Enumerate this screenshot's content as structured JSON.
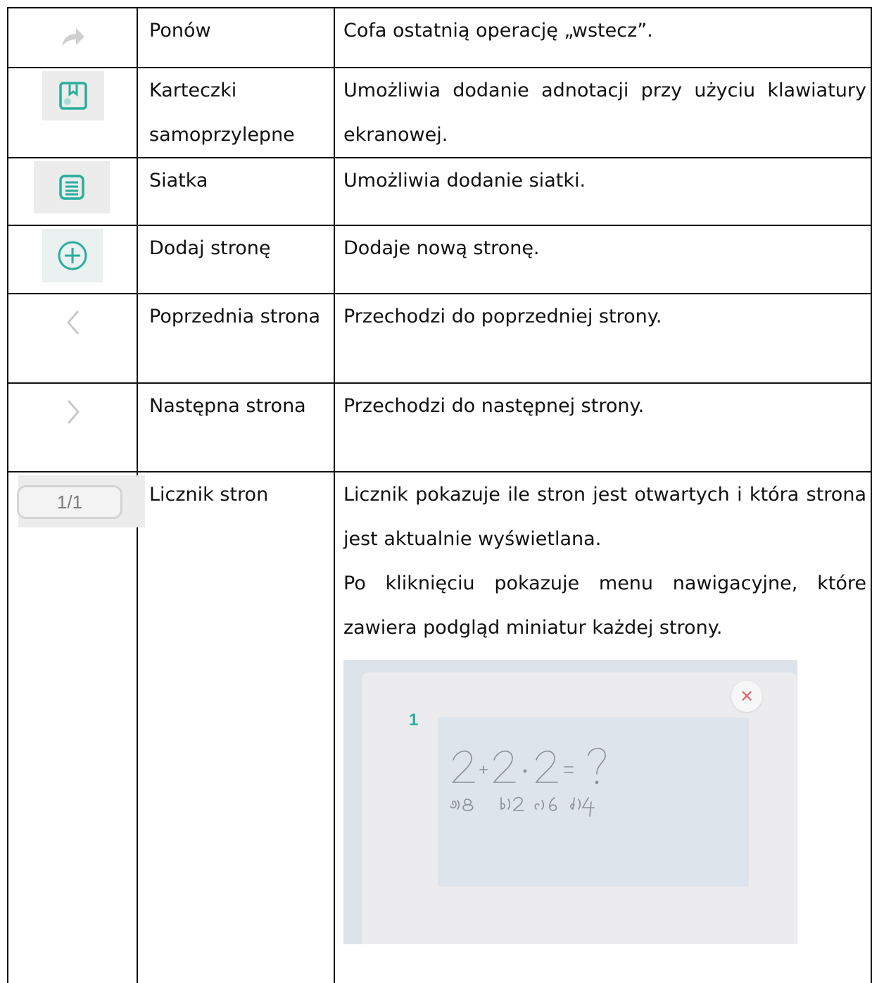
{
  "rows": [
    {
      "icon": "redo-arrow-icon",
      "name": "Ponów",
      "description": [
        "Cofa ostatnią operację „wstecz”."
      ]
    },
    {
      "icon": "sticky-note-icon",
      "name": "Karteczki samoprzylepne",
      "description": [
        "Umożliwia dodanie adnotacji przy użyciu klawiatury ekranowej."
      ]
    },
    {
      "icon": "grid-lines-icon",
      "name": "Siatka",
      "description": [
        "Umożliwia dodanie siatki."
      ]
    },
    {
      "icon": "add-page-plus-icon",
      "name": "Dodaj stronę",
      "description": [
        "Dodaje nową stronę."
      ]
    },
    {
      "icon": "chevron-left-icon",
      "name": "Poprzednia strona",
      "description": [
        "Przechodzi do poprzedniej strony."
      ]
    },
    {
      "icon": "chevron-right-icon",
      "name": "Następna strona",
      "description": [
        "Przechodzi do następnej strony."
      ]
    },
    {
      "icon": "page-counter",
      "counter_text": "1/1",
      "name": "Licznik stron",
      "description": [
        "Licznik pokazuje ile stron jest otwartych i która strona jest aktualnie wyświetlana.",
        "Po kliknięciu pokazuje menu nawigacyjne, które zawiera podgląd miniatur każdej strony."
      ],
      "nav_menu_preview": {
        "page_number": "1",
        "close_symbol": "✕",
        "thumbnail_equation": "2+2·2=?",
        "thumbnail_answers": [
          "a)8",
          "b)2",
          "c)6",
          "d)4"
        ]
      }
    }
  ],
  "colors": {
    "accent_teal": "#2aae9c",
    "close_red": "#e06a6a",
    "icon_grey": "#c8c8c8"
  }
}
